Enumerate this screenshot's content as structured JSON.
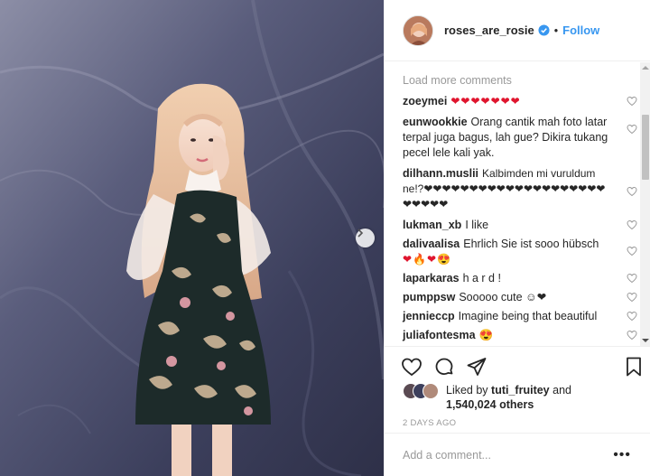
{
  "post": {
    "username": "roses_are_rosie",
    "follow_label": "Follow",
    "separator": "•",
    "verified_icon": "verified-badge-icon",
    "accent_color": "#3897f0"
  },
  "comments": {
    "load_more": "Load more comments",
    "items": [
      {
        "user": "zoeymei",
        "text": "❤❤❤❤❤❤❤"
      },
      {
        "user": "eunwookkie",
        "text": "Orang cantik mah foto latar terpal juga bagus, lah gue? Dikira tukang pecel lele kali yak."
      },
      {
        "user": "dilhann.muslii",
        "text": "Kalbimden mi vuruldum ne!?❤❤❤❤❤❤❤❤❤❤❤❤❤❤❤❤❤❤❤❤❤❤❤❤❤"
      },
      {
        "user": "lukman_xb",
        "text": "I like"
      },
      {
        "user": "dalivaalisa",
        "text": "Ehrlich Sie ist sooo hübsch"
      },
      {
        "user": "",
        "text": "❤🔥❤😍"
      },
      {
        "user": "laparkaras",
        "text": "h a r d !"
      },
      {
        "user": "pumppsw",
        "text": "Sooooo cute ☺❤"
      },
      {
        "user": "jenniecсp",
        "text": "Imagine being that beautiful"
      },
      {
        "user": "juliafontesma",
        "text": "😍"
      }
    ]
  },
  "likes": {
    "prefix": "Liked by",
    "liker": "tuti_fruitey",
    "conjunction": "and",
    "count": "1,540,024 others"
  },
  "timestamp": "2 DAYS AGO",
  "add_comment": {
    "placeholder": "Add a comment..."
  },
  "more_options": "•••"
}
